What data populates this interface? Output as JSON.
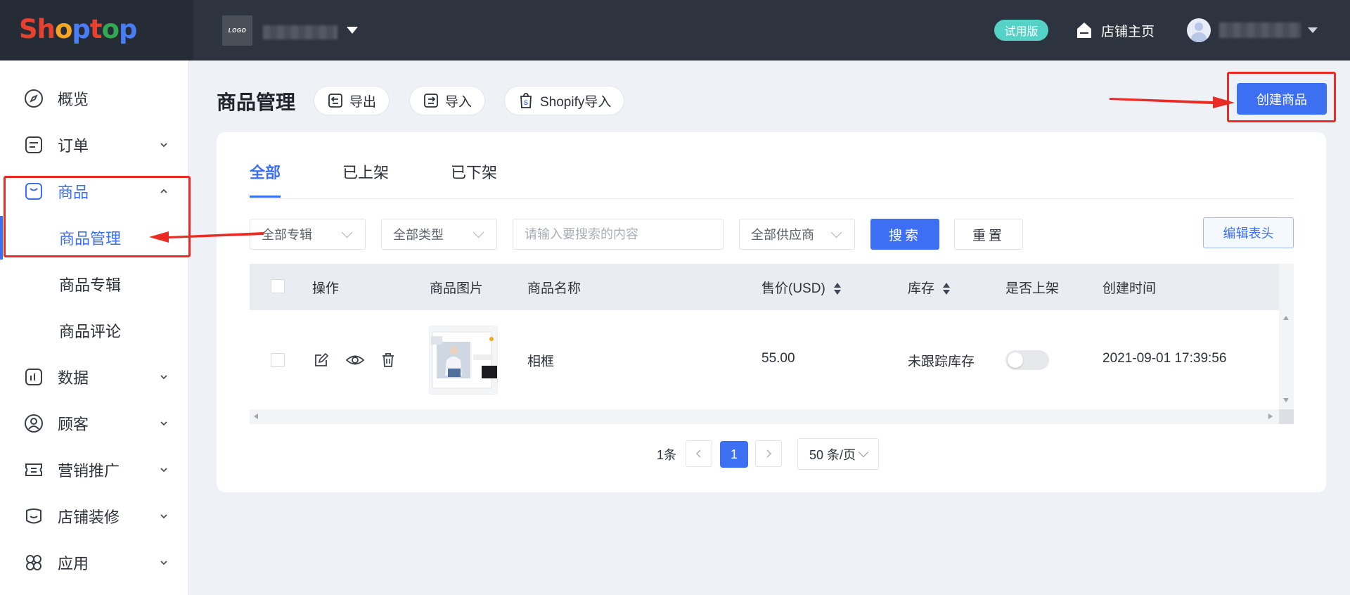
{
  "brand": {
    "logo_parts": [
      "Sh",
      "o",
      "p",
      "t",
      "o",
      "p"
    ],
    "logo_colors": [
      "#e8412f",
      "#f6a623",
      "#4a7cf6",
      "#e8412f",
      "#33a852",
      "#4a7cf6"
    ]
  },
  "topbar": {
    "store_logo_text": "LOGO",
    "trial_badge": "试用版",
    "shop_home_label": "店铺主页",
    "colors": {
      "background": "#2d3440",
      "trial_badge": "#53d2c5"
    }
  },
  "sidebar": {
    "items": [
      {
        "label": "概览",
        "icon": "compass-icon",
        "expandable": false
      },
      {
        "label": "订单",
        "icon": "order-icon",
        "expandable": true
      },
      {
        "label": "商品",
        "icon": "bag-icon",
        "expandable": true,
        "expanded": true,
        "active": true
      },
      {
        "label": "数据",
        "icon": "chart-icon",
        "expandable": true
      },
      {
        "label": "顾客",
        "icon": "user-icon",
        "expandable": true
      },
      {
        "label": "营销推广",
        "icon": "ticket-icon",
        "expandable": true
      },
      {
        "label": "店铺装修",
        "icon": "decor-icon",
        "expandable": true
      },
      {
        "label": "应用",
        "icon": "apps-icon",
        "expandable": true
      }
    ],
    "sub_items": [
      {
        "label": "商品管理",
        "active": true
      },
      {
        "label": "商品专辑"
      },
      {
        "label": "商品评论"
      }
    ]
  },
  "header": {
    "title": "商品管理",
    "buttons": {
      "export": "导出",
      "import": "导入",
      "shopify_import": "Shopify导入"
    },
    "create_button": "创建商品",
    "shopify_glyph": "S"
  },
  "tabs": [
    "全部",
    "已上架",
    "已下架"
  ],
  "active_tab": "全部",
  "filters": {
    "collection": "全部专辑",
    "type": "全部类型",
    "search_placeholder": "请输入要搜索的内容",
    "search_value": "",
    "supplier": "全部供应商",
    "search_button": "搜索",
    "reset_button": "重置",
    "edit_header_button": "编辑表头"
  },
  "table": {
    "columns": [
      "操作",
      "商品图片",
      "商品名称",
      "售价(USD)",
      "库存",
      "是否上架",
      "创建时间"
    ],
    "rows": [
      {
        "name": "相框",
        "price": "55.00",
        "stock": "未跟踪库存",
        "listed": false,
        "created": "2021-09-01 17:39:56"
      }
    ]
  },
  "pagination": {
    "total": "1条",
    "current_page": "1",
    "page_size": "50 条/页"
  },
  "colors": {
    "primary": "#3d6ff3",
    "annotation": "#ea2b23",
    "page_bg": "#eef1f5"
  }
}
